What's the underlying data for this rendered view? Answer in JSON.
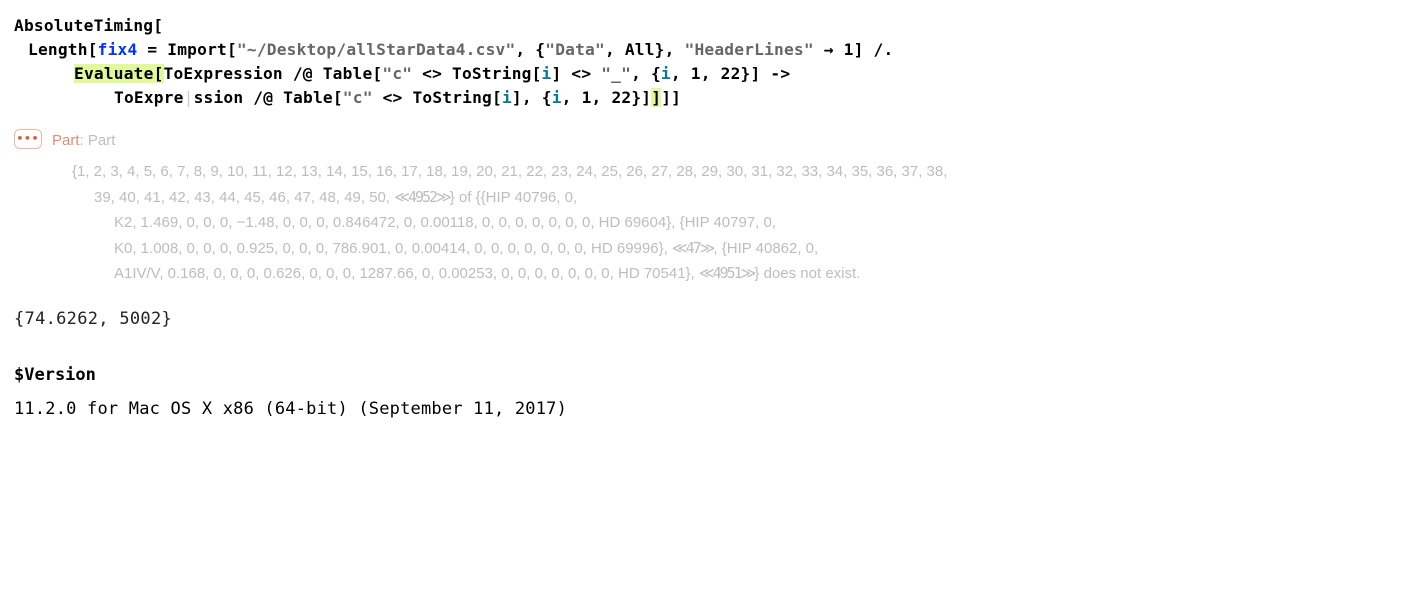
{
  "code": {
    "l1_a": "AbsoluteTiming",
    "l1_b": "[",
    "l2_a": "Length",
    "l2_b": "[",
    "l2_c": "fix4",
    "l2_d": " = ",
    "l2_e": "Import",
    "l2_f": "[",
    "l2_g": "\"~/Desktop/allStarData4.csv\"",
    "l2_h": ", {",
    "l2_i": "\"Data\"",
    "l2_j": ", All}, ",
    "l2_k": "\"HeaderLines\"",
    "l2_l": " → ",
    "l2_m": "1",
    "l2_n": "] /.",
    "l3_a": "Evaluate",
    "l3_b": "[",
    "l3_c": "ToExpression",
    "l3_d": " /@ ",
    "l3_e": "Table",
    "l3_f": "[",
    "l3_g": "\"c\"",
    "l3_h": " <> ",
    "l3_i": "ToString",
    "l3_j": "[",
    "l3_k": "i",
    "l3_l": "] <> ",
    "l3_m": "\"_\"",
    "l3_n": ", {",
    "l3_o": "i",
    "l3_p": ", ",
    "l3_q": "1",
    "l3_r": ", ",
    "l3_s": "22",
    "l3_t": "}] ->",
    "l4_a": "ToExpre",
    "l4_cursor": "|",
    "l4_b": "ssion",
    "l4_c": " /@ ",
    "l4_d": "Table",
    "l4_e": "[",
    "l4_f": "\"c\"",
    "l4_g": " <> ",
    "l4_h": "ToString",
    "l4_i": "[",
    "l4_j": "i",
    "l4_k": "], {",
    "l4_l": "i",
    "l4_m": ", ",
    "l4_n": "1",
    "l4_o": ", ",
    "l4_p": "22",
    "l4_q": "}]",
    "l4_r": "]",
    "l4_s": "]]"
  },
  "msg": {
    "badge": "•••",
    "tag": "Part",
    "colon": ": ",
    "head": "Part",
    "b1": "{1, 2, 3, 4, 5, 6, 7, 8, 9, 10, 11, 12, 13, 14, 15, 16, 17, 18, 19, 20, 21, 22, 23, 24, 25, 26, 27, 28, 29, 30, 31, 32, 33, 34, 35, 36, 37, 38,",
    "b2a": "39, 40, 41, 42, 43, 44, 45, 46, 47, 48, 49, 50, ",
    "b2s": "≪4952≫",
    "b2b": "} of {{HIP 40796, 0,",
    "b3": "K2, 1.469, 0, 0, 0, −1.48, 0, 0, 0, 0.846472, 0, 0.00118, 0, 0, 0, 0, 0, 0, 0, HD 69604}, {HIP 40797, 0,",
    "b4a": "K0, 1.008, 0, 0, 0, 0.925, 0, 0, 0, 786.901, 0, 0.00414, 0, 0, 0, 0, 0, 0, 0, HD 69996}, ",
    "b4s": "≪47≫",
    "b4b": ", {HIP 40862, 0,",
    "b5a": "A1IV/V, 0.168, 0, 0, 0, 0.626, 0, 0, 0, 1287.66, 0, 0.00253, 0, 0, 0, 0, 0, 0, 0, HD 70541}, ",
    "b5s": "≪4951≫",
    "b5b": "} does not exist."
  },
  "result": "{74.6262, 5002}",
  "versionIn": "$Version",
  "versionOut": "11.2.0 for Mac OS X x86 (64-bit) (September 11, 2017)"
}
